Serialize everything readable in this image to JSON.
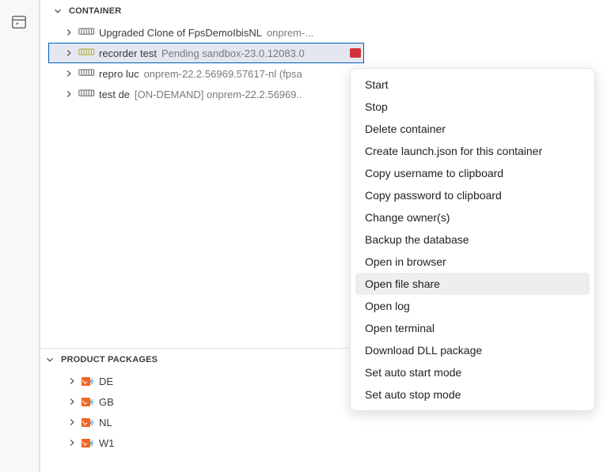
{
  "sections": {
    "container": {
      "title": "CONTAINER",
      "items": [
        {
          "name": "Upgraded Clone of FpsDemoIbisNL",
          "desc": "onprem-...",
          "iconColor": "#6a6a6a",
          "selected": false
        },
        {
          "name": "recorder test",
          "desc": "Pending sandbox-23.0.12083.0",
          "iconColor": "#b8b037",
          "selected": true,
          "statusRed": true
        },
        {
          "name": "repro luc",
          "desc": "onprem-22.2.56969.57617-nl (fpsa",
          "iconColor": "#6a6a6a",
          "selected": false
        },
        {
          "name": "test de",
          "desc": "[ON-DEMAND]  onprem-22.2.56969..",
          "iconColor": "#6a6a6a",
          "selected": false
        }
      ]
    },
    "packages": {
      "title": "PRODUCT PACKAGES",
      "items": [
        {
          "name": "DE"
        },
        {
          "name": "GB"
        },
        {
          "name": "NL"
        },
        {
          "name": "W1"
        }
      ]
    }
  },
  "contextMenu": {
    "items": [
      {
        "label": "Start"
      },
      {
        "label": "Stop"
      },
      {
        "label": "Delete container"
      },
      {
        "label": "Create launch.json for this container"
      },
      {
        "label": "Copy username to clipboard"
      },
      {
        "label": "Copy password to clipboard"
      },
      {
        "label": "Change owner(s)"
      },
      {
        "label": "Backup the database"
      },
      {
        "label": "Open in browser"
      },
      {
        "label": "Open file share",
        "hovered": true
      },
      {
        "label": "Open log"
      },
      {
        "label": "Open terminal"
      },
      {
        "label": "Download DLL package"
      },
      {
        "label": "Set auto start mode"
      },
      {
        "label": "Set auto stop mode"
      }
    ]
  }
}
